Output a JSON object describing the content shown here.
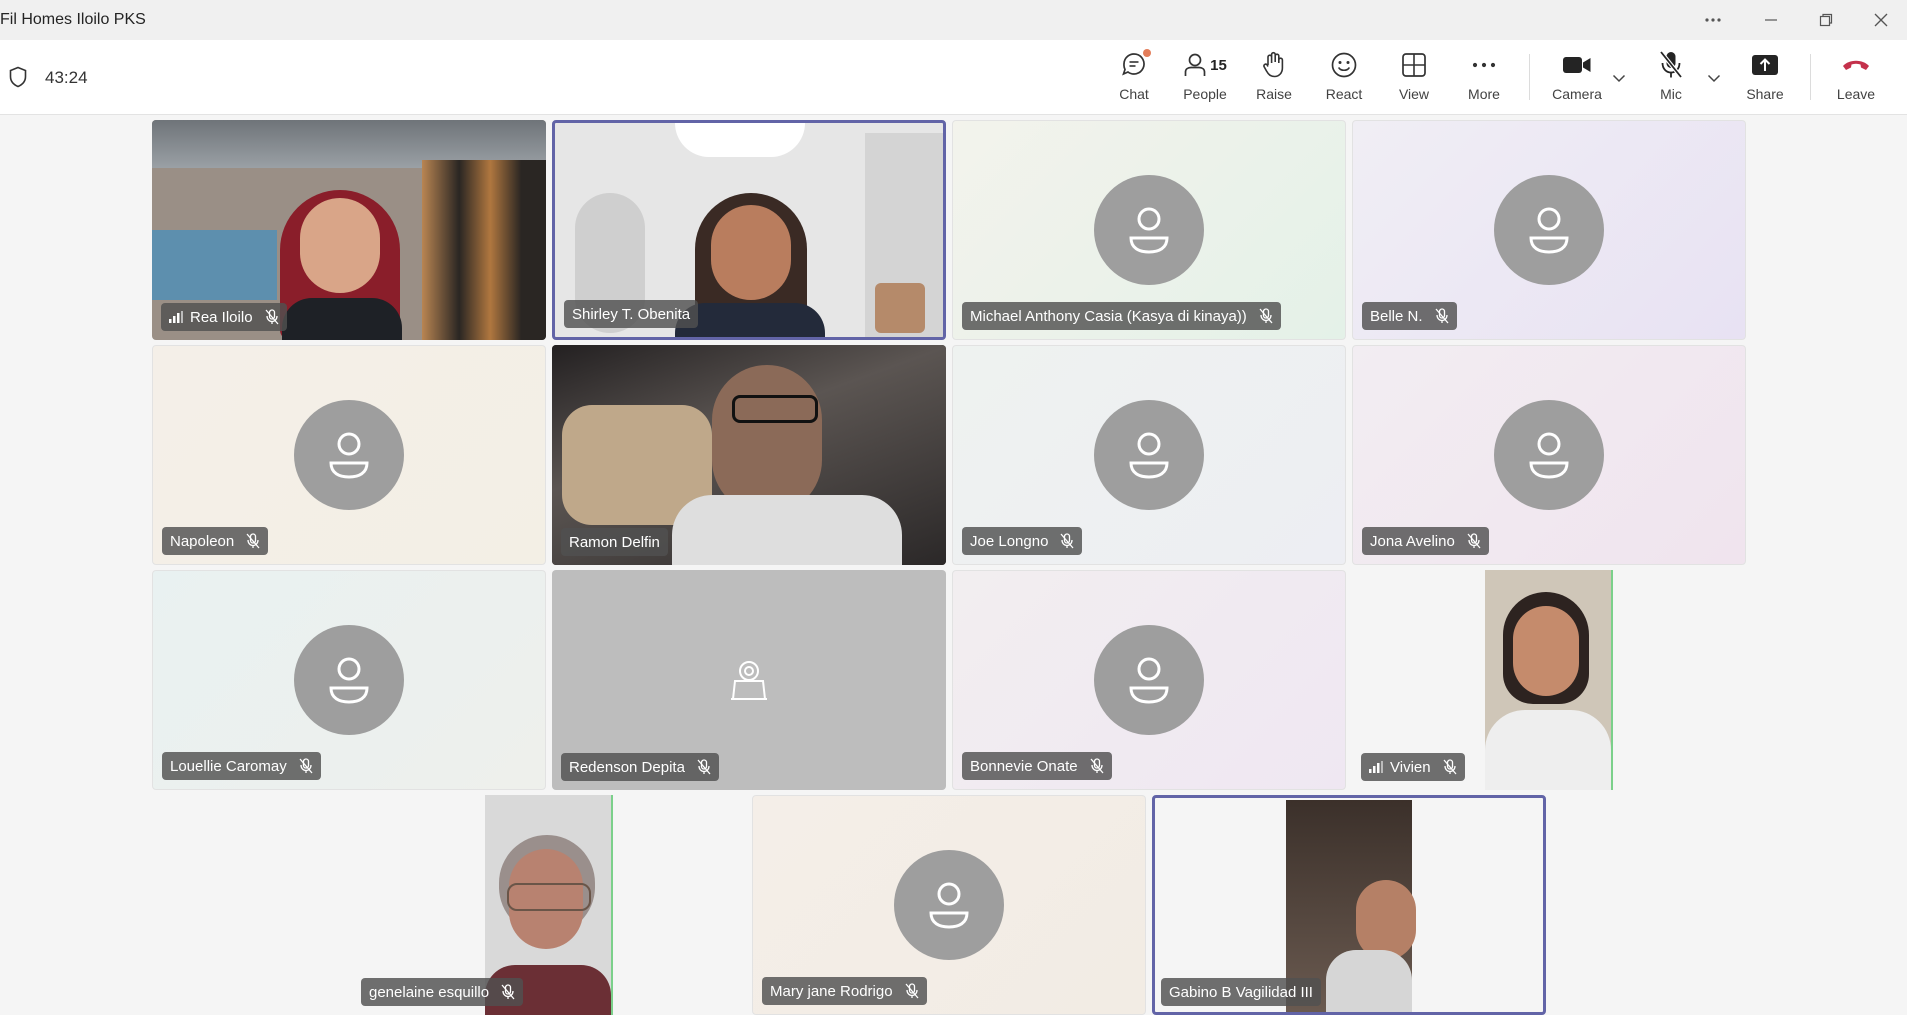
{
  "window": {
    "title": "Fil Homes Iloilo PKS",
    "controls": [
      "more-options",
      "minimize",
      "restore",
      "close"
    ]
  },
  "toolbar": {
    "timer": "43:24",
    "buttons": {
      "chat": "Chat",
      "people": "People",
      "people_count": "15",
      "raise": "Raise",
      "react": "React",
      "view": "View",
      "more": "More",
      "camera": "Camera",
      "mic": "Mic",
      "share": "Share",
      "leave": "Leave"
    }
  },
  "colors": {
    "accent": "#6264a7",
    "leave": "#c4314b",
    "avatar": "#9e9e9e",
    "nametag_bg": "#505050"
  },
  "participants": [
    {
      "name": "Rea Iloilo",
      "video": true,
      "signal_icon": true,
      "muted": true
    },
    {
      "name": "Shirley T. Obenita",
      "video": true,
      "active_speaker": true,
      "muted": false
    },
    {
      "name": "Michael Anthony Casia (Kasya di kinaya))",
      "video": false,
      "muted": true
    },
    {
      "name": "Belle N.",
      "video": false,
      "muted": true
    },
    {
      "name": "Napoleon",
      "video": false,
      "muted": true
    },
    {
      "name": "Ramon Delfin",
      "video": true,
      "muted": false
    },
    {
      "name": "Joe Longno",
      "video": false,
      "muted": true
    },
    {
      "name": "Jona Avelino",
      "video": false,
      "muted": true
    },
    {
      "name": "Louellie Caromay",
      "video": false,
      "muted": true
    },
    {
      "name": "Redenson Depita",
      "video": false,
      "camera_off_icon": true,
      "muted": true
    },
    {
      "name": "Bonnevie Onate",
      "video": false,
      "muted": true
    },
    {
      "name": "Vivien",
      "video": true,
      "signal_icon": true,
      "muted": true
    },
    {
      "name": "genelaine esquillo",
      "video": true,
      "muted": true
    },
    {
      "name": "Mary jane Rodrigo",
      "video": false,
      "muted": true
    },
    {
      "name": "Gabino B Vagilidad III",
      "video": true,
      "active_speaker": true,
      "muted": false
    }
  ]
}
